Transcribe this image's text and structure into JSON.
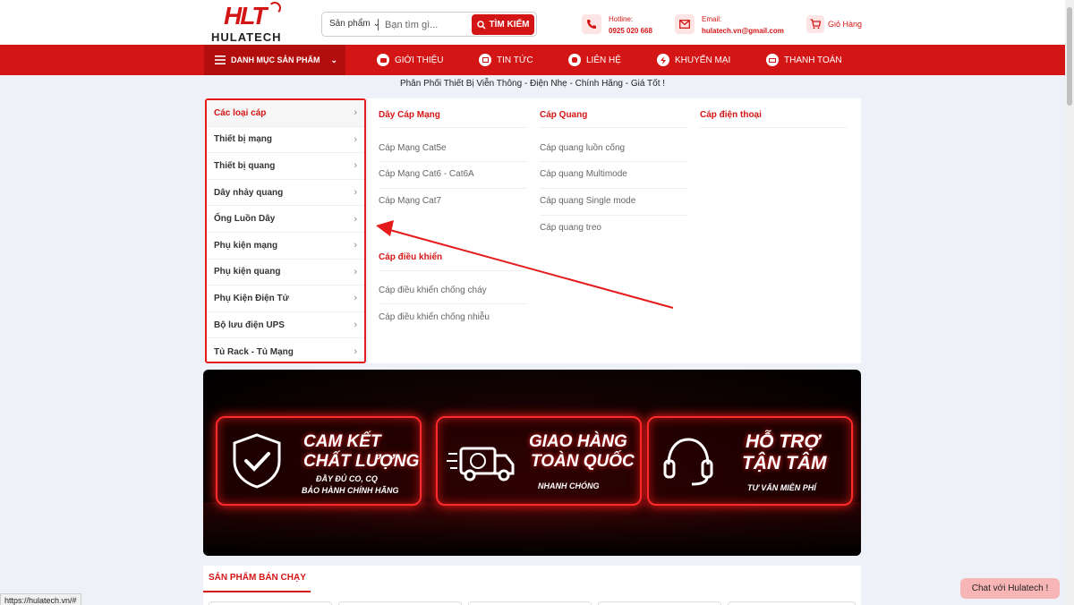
{
  "logo": {
    "mark": "HLT",
    "text": "HULATECH"
  },
  "search": {
    "category": "Sản phẩm",
    "placeholder": "Bạn tìm gì...",
    "button": "TÌM KIẾM"
  },
  "hotline": {
    "label": "Hotline:",
    "value": "0925 020 668"
  },
  "email": {
    "label": "Email:",
    "value": "hulatech.vn@gmail.com"
  },
  "cart": {
    "label": "Giỏ Hàng"
  },
  "nav": {
    "categories_button": "DANH MỤC SẢN PHẨM",
    "items": [
      {
        "label": "GIỚI THIỆU",
        "icon": "info-icon"
      },
      {
        "label": "TIN TỨC",
        "icon": "news-icon"
      },
      {
        "label": "LIÊN HỆ",
        "icon": "phone-icon"
      },
      {
        "label": "KHUYẾN MẠI",
        "icon": "bolt-icon"
      },
      {
        "label": "THANH TOÁN",
        "icon": "card-icon"
      }
    ]
  },
  "tagline": "Phân Phối Thiết Bị Viễn Thông - Điện Nhẹ - Chính Hãng - Giá Tốt !",
  "categories": [
    "Các loại cáp",
    "Thiết bị mạng",
    "Thiết bị quang",
    "Dây nhảy quang",
    "Ống Luồn Dây",
    "Phụ kiện mạng",
    "Phụ kiện quang",
    "Phụ Kiện Điện Tử",
    "Bộ lưu điện UPS",
    "Tủ Rack - Tủ Mạng"
  ],
  "mega": {
    "groups": [
      {
        "title": "Dây Cáp Mạng",
        "links": [
          "Cáp Mạng Cat5e",
          "Cáp Mạng Cat6 - Cat6A",
          "Cáp Mạng Cat7"
        ]
      },
      {
        "title": "Cáp Quang",
        "links": [
          "Cáp quang luồn cống",
          "Cáp quang Multimode",
          "Cáp quang Single mode",
          "Cáp quang treo"
        ]
      },
      {
        "title": "Cáp điện thoại",
        "links": []
      },
      {
        "title": "Cáp điều khiển",
        "links": [
          "Cáp điều khiển chống cháy",
          "Cáp điều khiển chống nhiễu"
        ]
      }
    ]
  },
  "banner": {
    "cards": [
      {
        "title1": "CAM KẾT",
        "title2": "CHẤT LƯỢNG",
        "sub1": "ĐẦY ĐỦ CO, CQ",
        "sub2": "BẢO HÀNH CHÍNH HÃNG"
      },
      {
        "title1": "GIAO HÀNG",
        "title2": "TOÀN QUỐC",
        "sub1": "NHANH CHÓNG",
        "sub2": ""
      },
      {
        "title1": "HỖ TRỢ",
        "title2": "TẬN TÂM",
        "sub1": "TƯ VẤN MIỄN PHÍ",
        "sub2": ""
      }
    ]
  },
  "products": {
    "title": "SẢN PHẨM BÁN CHẠY"
  },
  "status_url": "https://hulatech.vn/#",
  "chat": "Chat với Hulatech !",
  "colors": {
    "brand": "#d41515",
    "highlight": "#e51a1a"
  }
}
